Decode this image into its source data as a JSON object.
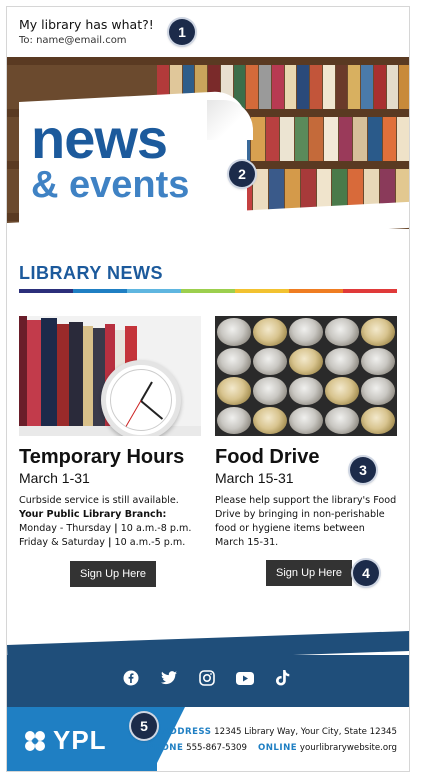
{
  "email": {
    "subject": "My library has what?!",
    "to": "To: name@email.com"
  },
  "callouts": [
    "1",
    "2",
    "3",
    "4",
    "5"
  ],
  "hero": {
    "title": "news",
    "subtitle": "& events"
  },
  "section": {
    "title": "LIBRARY NEWS",
    "stripe_colors": [
      "#2b2f7a",
      "#1f7fc3",
      "#5fb6e0",
      "#9ccf4e",
      "#f2c230",
      "#ef7d22",
      "#e03a3a"
    ]
  },
  "columns": [
    {
      "title": "Temporary Hours",
      "date": "March 1-31",
      "line1": "Curbside service is still available.",
      "line2": "Your Public Library Branch:",
      "line3a": "Monday - Thursday",
      "line3b": "10 a.m.-8 p.m.",
      "line4a": "Friday & Saturday",
      "line4b": "10 a.m.-5 p.m.",
      "pipe": "|",
      "button": "Sign Up Here"
    },
    {
      "title": "Food Drive",
      "date": "March 15-31",
      "line1": "Please help support the library's Food",
      "line2": "Drive by bringing in non-perishable",
      "line3": "food or hygiene items between",
      "line4": "March 15-31.",
      "button": "Sign Up Here"
    }
  ],
  "social": [
    "facebook-icon",
    "twitter-icon",
    "instagram-icon",
    "youtube-icon",
    "tiktok-icon"
  ],
  "footer": {
    "logo": "YPL",
    "address_label": "ADDRESS",
    "address": "12345 Library Way, Your City, State 12345",
    "phone_label": "PHONE",
    "phone": "555-867-5309",
    "online_label": "ONLINE",
    "online": "yourlibrarywebsite.org"
  },
  "colors": {
    "brand_dark": "#1c5a9c",
    "brand_light": "#1f7fc3",
    "footer_bar": "#1f4e7a",
    "button": "#333333"
  }
}
